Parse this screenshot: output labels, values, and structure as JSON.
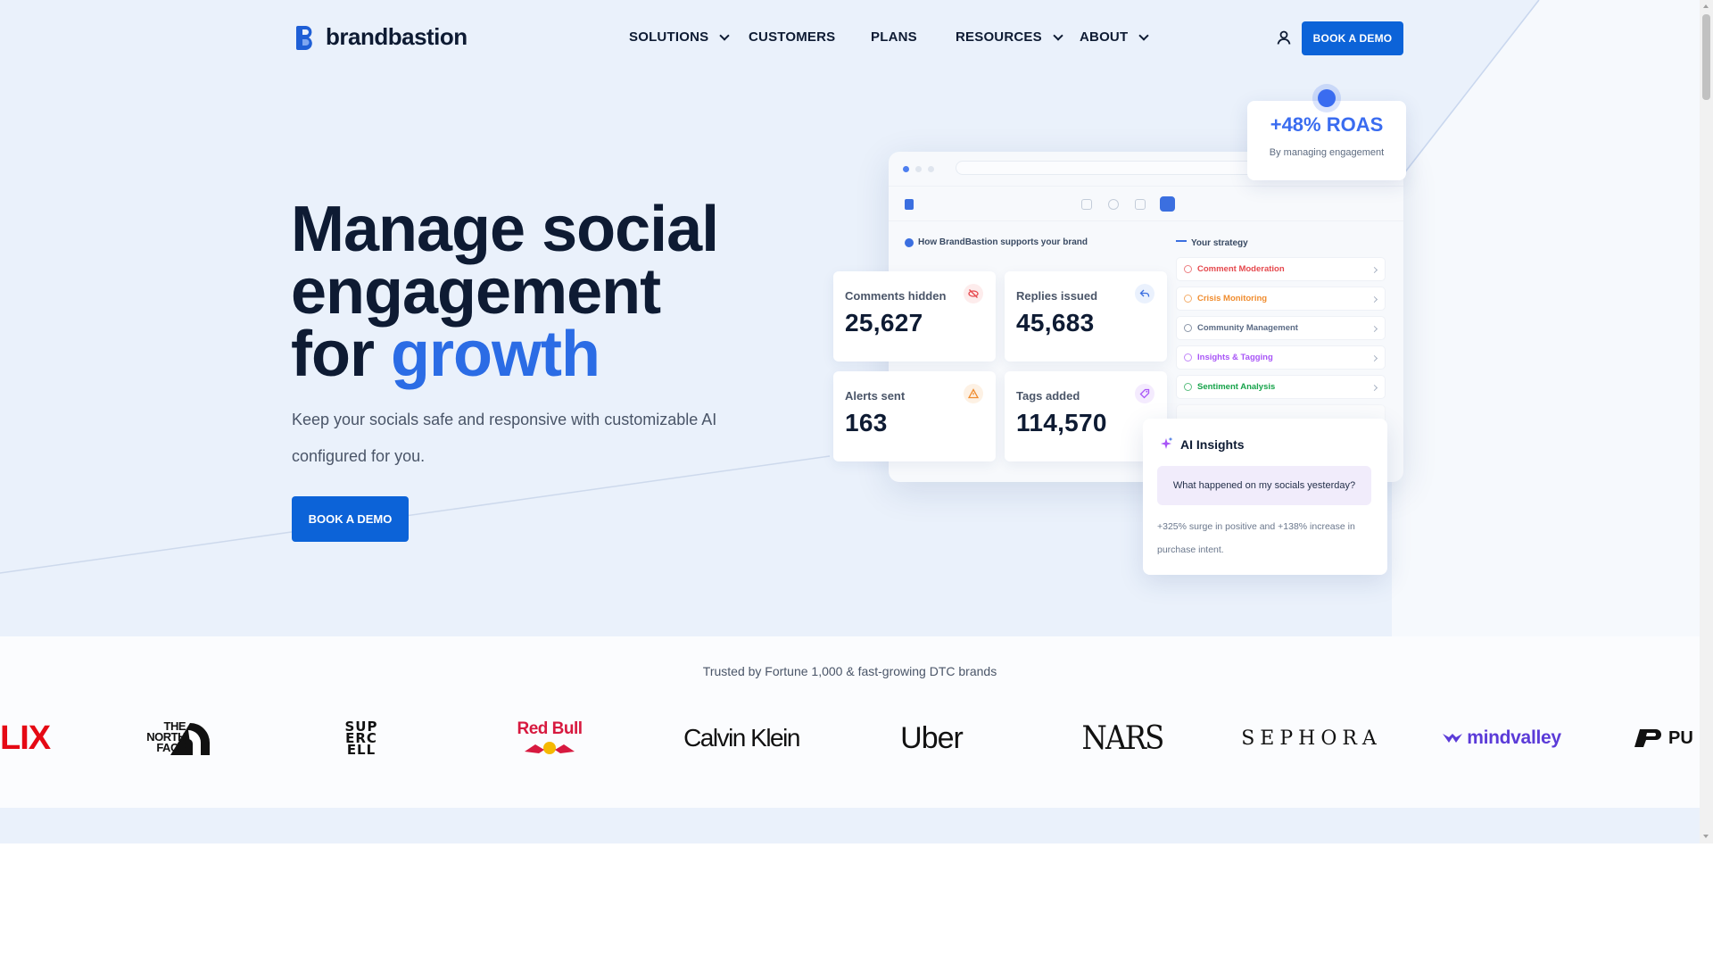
{
  "brand": {
    "name": "brandbastion"
  },
  "nav": {
    "items": [
      {
        "label": "SOLUTIONS",
        "has_dropdown": true
      },
      {
        "label": "CUSTOMERS",
        "has_dropdown": false
      },
      {
        "label": "PLANS",
        "has_dropdown": false
      },
      {
        "label": "RESOURCES",
        "has_dropdown": true
      },
      {
        "label": "ABOUT",
        "has_dropdown": true
      }
    ],
    "account_icon": "user-icon",
    "cta_label": "BOOK A DEMO"
  },
  "hero": {
    "title_line1": "Manage social",
    "title_line2": "engagement",
    "title_line3_prefix": "for ",
    "title_line3_accent": "growth",
    "subtitle": "Keep your socials safe and responsive with customizable AI configured for you.",
    "cta_label": "BOOK A DEMO"
  },
  "dashboard": {
    "support_heading": "How BrandBastion supports your brand",
    "strategy_heading": "Your strategy",
    "stats": [
      {
        "label": "Comments hidden",
        "value": "25,627",
        "icon": "eye-off-icon",
        "color": "#e5484d"
      },
      {
        "label": "Replies issued",
        "value": "45,683",
        "icon": "reply-icon",
        "color": "#3b6fe0"
      },
      {
        "label": "Alerts sent",
        "value": "163",
        "icon": "warning-icon",
        "color": "#f08c2e"
      },
      {
        "label": "Tags added",
        "value": "114,570",
        "icon": "tag-icon",
        "color": "#a855f7"
      }
    ],
    "strategy": [
      {
        "label": "Comment Moderation",
        "color": "#e5484d"
      },
      {
        "label": "Crisis Monitoring",
        "color": "#f08c2e"
      },
      {
        "label": "Community Management",
        "color": "#5b6b85"
      },
      {
        "label": "Insights & Tagging",
        "color": "#a855f7"
      },
      {
        "label": "Sentiment Analysis",
        "color": "#16a34a"
      }
    ]
  },
  "roas": {
    "value": "+48% ROAS",
    "caption": "By managing engagement"
  },
  "ai_insights": {
    "title": "AI Insights",
    "question": "What happened on my socials yesterday?",
    "answer": "+325% surge in positive and +138% increase in purchase intent."
  },
  "trusted": {
    "text": "Trusted by Fortune 1,000 & fast-growing DTC brands",
    "logos": [
      "LIX",
      "THE NORTH FACE",
      "SUPERCELL",
      "Red Bull",
      "Calvin Klein",
      "Uber",
      "NARS",
      "SEPHORA",
      "mindvalley",
      "PU"
    ]
  },
  "colors": {
    "accent": "#2b6ce5",
    "button": "#0c63d8",
    "hero_bg": "#eaf1fb",
    "text_dark": "#0e1b33"
  }
}
